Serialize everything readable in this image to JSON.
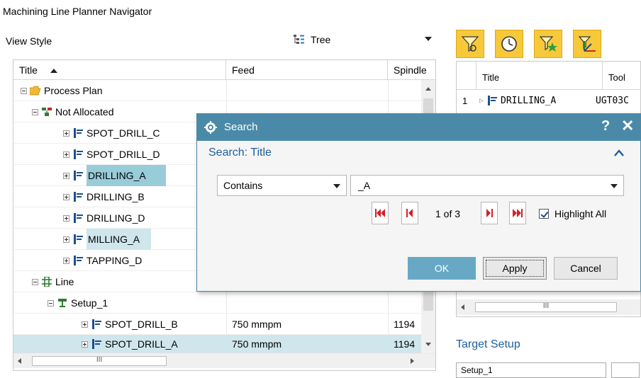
{
  "app": {
    "title": "Machining Line Planner Navigator"
  },
  "view_style": {
    "label": "View Style",
    "value": "Tree"
  },
  "navigator": {
    "columns": {
      "title": "Title",
      "feed": "Feed",
      "spindle": "Spindle"
    },
    "rows": [
      {
        "title": "Process Plan",
        "feed": "",
        "spindle": ""
      },
      {
        "title": "Not Allocated",
        "feed": "",
        "spindle": ""
      },
      {
        "title": "SPOT_DRILL_C",
        "feed": "",
        "spindle": ""
      },
      {
        "title": "SPOT_DRILL_D",
        "feed": "",
        "spindle": ""
      },
      {
        "title": "DRILLING_A",
        "feed": "",
        "spindle": ""
      },
      {
        "title": "DRILLING_B",
        "feed": "",
        "spindle": ""
      },
      {
        "title": "DRILLING_D",
        "feed": "",
        "spindle": ""
      },
      {
        "title": "MILLING_A",
        "feed": "",
        "spindle": ""
      },
      {
        "title": "TAPPING_D",
        "feed": "",
        "spindle": ""
      },
      {
        "title": "Line",
        "feed": "",
        "spindle": ""
      },
      {
        "title": "Setup_1",
        "feed": "",
        "spindle": ""
      },
      {
        "title": "SPOT_DRILL_B",
        "feed": "750 mmpm",
        "spindle": "1194"
      },
      {
        "title": "SPOT_DRILL_A",
        "feed": "750 mmpm",
        "spindle": "1194"
      }
    ],
    "hscroll_grip": "III"
  },
  "right_panel": {
    "columns": {
      "title": "Title",
      "tool": "Tool"
    },
    "rows": [
      {
        "index": "1",
        "title": "DRILLING_A",
        "tool": "UGT03C"
      }
    ],
    "hscroll_grip": "III",
    "target_setup_label": "Target Setup",
    "target_setup_value": "Setup_1"
  },
  "dialog": {
    "title": "Search",
    "help": "?",
    "close": "✕",
    "group_title": "Search: Title",
    "mode": "Contains",
    "query": "_A",
    "count": "1 of 3",
    "highlight_all_label": "Highlight All",
    "highlight_all_checked": true,
    "ok_label": "OK",
    "apply_label": "Apply",
    "cancel_label": "Cancel"
  },
  "colors": {
    "dialog_titlebar": "#4a8aa8",
    "selection_strong": "#99ccd9",
    "selection_light": "#cfe6ec",
    "toolbar_button": "#f7c93a",
    "accent_text": "#1e5e9c",
    "nav_red": "#d42027"
  },
  "icons": [
    "tree-view-icon",
    "folder-open-icon",
    "unallocated-group-icon",
    "operation-icon",
    "line-icon",
    "setup-icon",
    "gear-icon",
    "funnel-filter-icon",
    "clock-filter-icon",
    "star-filter-icon",
    "axis-filter-icon"
  ]
}
